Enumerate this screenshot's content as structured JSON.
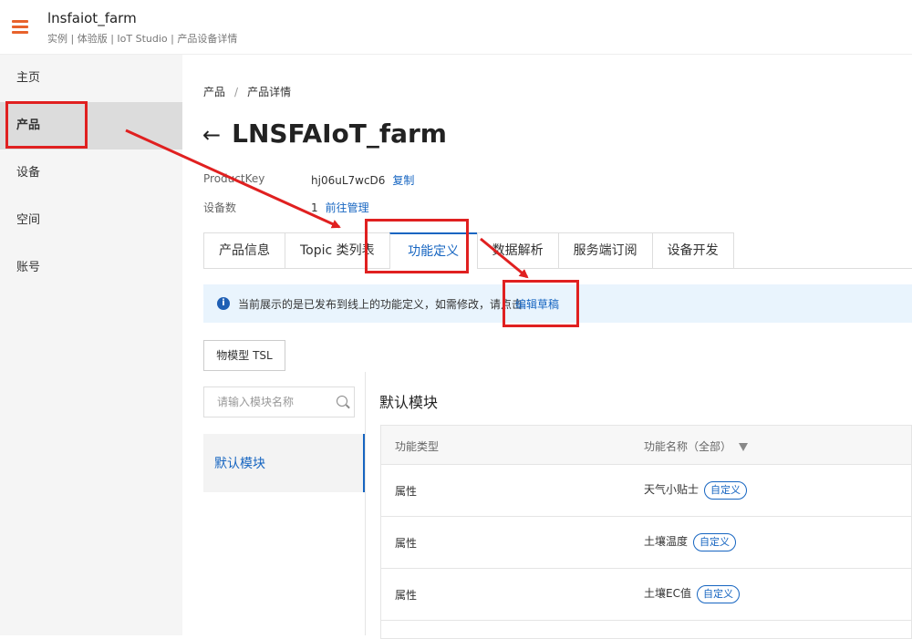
{
  "header": {
    "title": "lnsfaiot_farm",
    "subtitle": "实例 | 体验版 | IoT Studio | 产品设备详情"
  },
  "sidebar": {
    "items": [
      {
        "label": "主页"
      },
      {
        "label": "产品"
      },
      {
        "label": "设备"
      },
      {
        "label": "空间"
      },
      {
        "label": "账号"
      }
    ]
  },
  "breadcrumb": {
    "root": "产品",
    "separator": "/",
    "current": "产品详情"
  },
  "page": {
    "back_glyph": "←",
    "title": "LNSFAIoT_farm"
  },
  "meta": {
    "product_key_label": "ProductKey",
    "product_key_value": "hj06uL7wcD6",
    "copy_link": "复制",
    "device_count_label": "设备数",
    "device_count_value": "1",
    "manage_link": "前往管理"
  },
  "tabs": [
    {
      "label": "产品信息"
    },
    {
      "label": "Topic 类列表"
    },
    {
      "label": "功能定义"
    },
    {
      "label": "数据解析"
    },
    {
      "label": "服务端订阅"
    },
    {
      "label": "设备开发"
    }
  ],
  "notice": {
    "icon": "info-icon",
    "text": "当前展示的是已发布到线上的功能定义，如需修改，请点击",
    "link": "编辑草稿"
  },
  "tsl_button": "物模型 TSL",
  "search": {
    "placeholder": "请输入模块名称"
  },
  "modules": [
    {
      "label": "默认模块"
    }
  ],
  "section_title": "默认模块",
  "table": {
    "headers": {
      "type": "功能类型",
      "name": "功能名称（全部）"
    },
    "rows": [
      {
        "type": "属性",
        "name": "天气小贴士",
        "tag": "自定义"
      },
      {
        "type": "属性",
        "name": "土壤温度",
        "tag": "自定义"
      },
      {
        "type": "属性",
        "name": "土壤EC值",
        "tag": "自定义"
      }
    ]
  },
  "colors": {
    "accent": "#1665c1",
    "brand": "#e8622c",
    "highlight": "#e02020"
  }
}
